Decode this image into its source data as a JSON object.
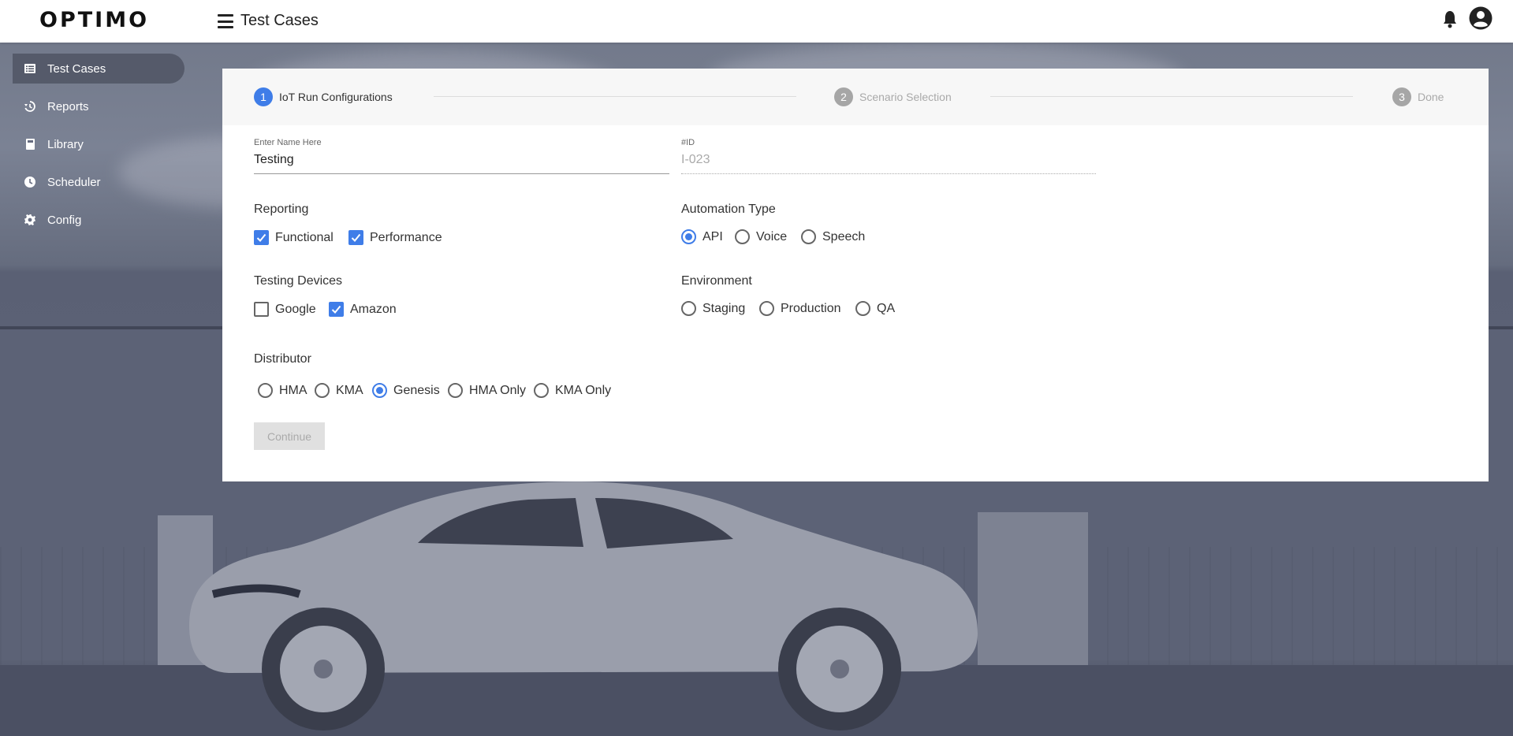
{
  "header": {
    "logo": "OPTIMO",
    "title": "Test Cases"
  },
  "sidebar": {
    "items": [
      {
        "label": "Test Cases",
        "icon": "list-icon",
        "active": true
      },
      {
        "label": "Reports",
        "icon": "history-icon",
        "active": false
      },
      {
        "label": "Library",
        "icon": "book-icon",
        "active": false
      },
      {
        "label": "Scheduler",
        "icon": "clock-icon",
        "active": false
      },
      {
        "label": "Config",
        "icon": "gear-icon",
        "active": false
      }
    ]
  },
  "stepper": {
    "steps": [
      {
        "number": "1",
        "label": "IoT Run Configurations",
        "active": true
      },
      {
        "number": "2",
        "label": "Scenario Selection",
        "active": false
      },
      {
        "number": "3",
        "label": "Done",
        "active": false
      }
    ]
  },
  "form": {
    "name_label": "Enter Name Here",
    "name_value": "Testing",
    "id_label": "#ID",
    "id_value": "I-023",
    "reporting": {
      "title": "Reporting",
      "options": [
        {
          "label": "Functional",
          "checked": true
        },
        {
          "label": "Performance",
          "checked": true
        }
      ]
    },
    "automation_type": {
      "title": "Automation Type",
      "options": [
        {
          "label": "API",
          "checked": true
        },
        {
          "label": "Voice",
          "checked": false
        },
        {
          "label": "Speech",
          "checked": false
        }
      ]
    },
    "testing_devices": {
      "title": "Testing Devices",
      "options": [
        {
          "label": "Google",
          "checked": false
        },
        {
          "label": "Amazon",
          "checked": true
        }
      ]
    },
    "environment": {
      "title": "Environment",
      "options": [
        {
          "label": "Staging",
          "checked": false
        },
        {
          "label": "Production",
          "checked": false
        },
        {
          "label": "QA",
          "checked": false
        }
      ]
    },
    "distributor": {
      "title": "Distributor",
      "options": [
        {
          "label": "HMA",
          "checked": false
        },
        {
          "label": "KMA",
          "checked": false
        },
        {
          "label": "Genesis",
          "checked": true
        },
        {
          "label": "HMA Only",
          "checked": false
        },
        {
          "label": "KMA Only",
          "checked": false
        }
      ]
    },
    "continue_label": "Continue"
  },
  "colors": {
    "accent": "#3f7de8",
    "sidebar_active": "#505564"
  }
}
